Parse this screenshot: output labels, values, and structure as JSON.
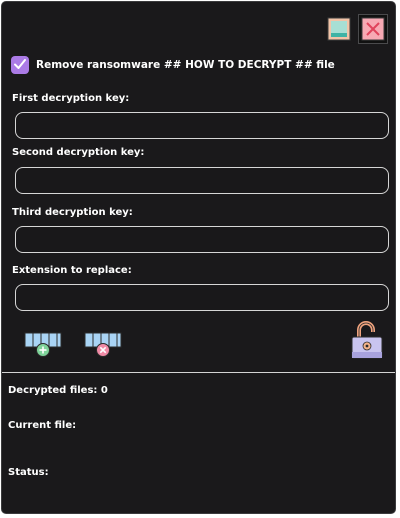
{
  "window": {
    "minimize_icon": "minimize-icon",
    "close_icon": "close-icon"
  },
  "options": {
    "remove_note_label": "Remove ransomware ## HOW TO DECRYPT ## file",
    "remove_note_checked": true
  },
  "fields": {
    "first_key_label": "First decryption key:",
    "first_key_value": "",
    "second_key_label": "Second decryption key:",
    "second_key_value": "",
    "third_key_label": "Third decryption key:",
    "third_key_value": "",
    "extension_label": "Extension to replace:",
    "extension_value": ""
  },
  "toolbar": {
    "add_icon": "add-file-icon",
    "remove_icon": "remove-file-icon",
    "decrypt_icon": "unlock-padlock-icon"
  },
  "status": {
    "decrypted_label": "Decrypted files:",
    "decrypted_count": "0",
    "current_file_label": "Current file:",
    "current_file_value": "",
    "status_label": "Status:",
    "status_value": ""
  },
  "colors": {
    "background": "#1a191b",
    "accent": "#ab7be6",
    "text": "#ffffff",
    "input_border": "#d6d6d6"
  }
}
